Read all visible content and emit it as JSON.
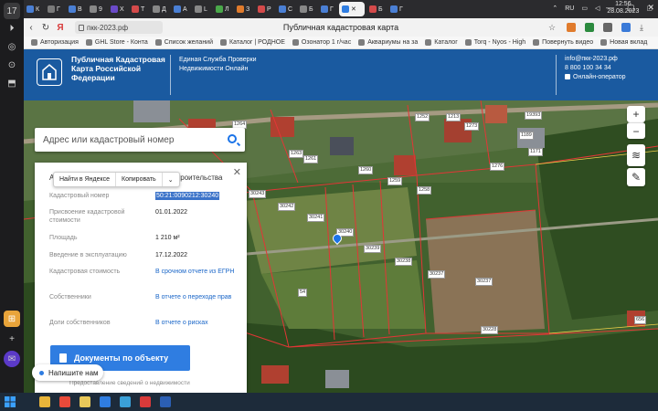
{
  "browser": {
    "side_panel": [
      "17",
      "⏵",
      "◎",
      "⊙",
      "⬒",
      "⊞",
      "✉"
    ],
    "tabs": [
      {
        "label": "К",
        "color": "#4a7fd4"
      },
      {
        "label": "Г",
        "color": "#7a7a7a"
      },
      {
        "label": "В",
        "color": "#4a7fd4"
      },
      {
        "label": "9",
        "color": "#888"
      },
      {
        "label": "Х",
        "color": "#6a4ac8"
      },
      {
        "label": "Т",
        "color": "#d44a4a"
      },
      {
        "label": "Д",
        "color": "#888"
      },
      {
        "label": "А",
        "color": "#4a7fd4"
      },
      {
        "label": "L",
        "color": "#888"
      },
      {
        "label": "Л",
        "color": "#4aa84a"
      },
      {
        "label": "З",
        "color": "#e07b2c"
      },
      {
        "label": "Р",
        "color": "#d44a4a"
      },
      {
        "label": "С",
        "color": "#4a7fd4"
      },
      {
        "label": "Б",
        "color": "#888"
      },
      {
        "label": "Г",
        "color": "#4a7fd4"
      },
      {
        "label": "Б",
        "color": "#d44a4a"
      },
      {
        "label": "Г",
        "color": "#4a7fd4"
      }
    ],
    "active_tab_label": "",
    "url": "пкк-2023.рф",
    "page_title": "Публичная кадастровая карта",
    "bookmarks": [
      "Авторизация",
      "GHL Store - Конта",
      "Список желаний",
      "Каталог | РОДНОЕ",
      "Озонатор 1 г/час",
      "Аквариумы на за",
      "Каталог",
      "Torq - Nyos - High",
      "Повернуть видео",
      "Новая вклад"
    ]
  },
  "site": {
    "name": "Публичная Кадастровая Карта Российской Федерации",
    "service": "Единая Служба Проверки Недвижимости Онлайн",
    "email": "info@пкк-2023.рф",
    "phone": "8 800 100 34 34",
    "online_operator": "Онлайн-оператор"
  },
  "search": {
    "placeholder": "Адрес или кадастровый номер"
  },
  "context_menu": {
    "find_yandex": "Найти в Яндексе",
    "copy": "Копировать"
  },
  "info_panel": {
    "header_first": "А",
    "header_tail": "строительства",
    "rows": [
      {
        "label": "Кадастровый номер",
        "value": "50:21:0090212:30240"
      },
      {
        "label": "Присвоение кадастровой стоимости",
        "value": "01.01.2022"
      },
      {
        "label": "Площадь",
        "value": "1 210 м²"
      },
      {
        "label": "Введение в эксплуатацию",
        "value": "17.12.2022"
      },
      {
        "label": "Кадастровая стоимость",
        "value": "В срочном отчете из ЕГРН"
      },
      {
        "label": "Собственники",
        "value": "В отчете о переходе прав"
      },
      {
        "label": "Доли собственников",
        "value": "В отчете о рисках"
      }
    ],
    "doc_button": "Документы по объекту",
    "footnote": "Предоставление сведений о недвижимости"
  },
  "chat": {
    "label": "Напишите нам"
  },
  "map": {
    "parcels": [
      "1264",
      "1252",
      "1263",
      "1261",
      "1260",
      "1259",
      "1258",
      "30243",
      "30242",
      "30241",
      "30240",
      "30239",
      "30238",
      "30237",
      "30237",
      "30228",
      "54",
      "1273",
      "1189",
      "1171",
      "1276",
      "19393",
      "1213",
      "656"
    ],
    "zoom_in": "+",
    "zoom_out": "−"
  },
  "taskbar": {
    "lang": "RU",
    "time": "12:56",
    "date": "28.08.2023",
    "apps": [
      {
        "name": "chrome-icon",
        "color": "#e8b53a"
      },
      {
        "name": "yandex-icon",
        "color": "#e84a3a"
      },
      {
        "name": "folder-icon",
        "color": "#e8c85a"
      },
      {
        "name": "outlook-icon",
        "color": "#2f7de1"
      },
      {
        "name": "picture-icon",
        "color": "#3aa0d8"
      },
      {
        "name": "yandex-browser-icon",
        "color": "#d83a3a"
      },
      {
        "name": "word-icon",
        "color": "#2b5fb4"
      }
    ]
  }
}
